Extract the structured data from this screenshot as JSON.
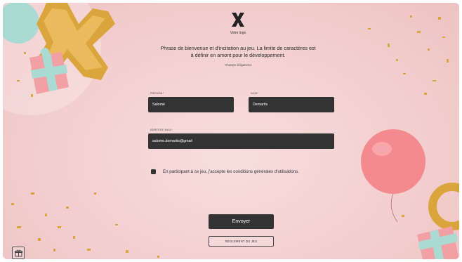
{
  "logo": {
    "caption": "Votre logo",
    "icon": "x-logo-icon"
  },
  "intro": {
    "line1": "Phrase de bienvenue et d'incitation au jeu. La limite de caractères est",
    "line2": "à définir en amont pour le développement.",
    "required_note": "*champs obligatoires"
  },
  "form": {
    "firstname": {
      "label": "PRÉNOM*",
      "value": "Salomé"
    },
    "lastname": {
      "label": "NOM*",
      "value": "Demartis"
    },
    "email": {
      "label": "ADRESSE MAIL*",
      "value": "salome.demartis@gmail"
    },
    "consent": {
      "label": "En participant à ce jeu, j'accepte les conditions générales d'utilisations.",
      "checked": false
    }
  },
  "actions": {
    "submit": "Envoyer",
    "rules": "RÉGLEMENT DU JEU"
  },
  "colors": {
    "background": "#f3cfcf",
    "field": "#333333",
    "gold": "#d9a53c",
    "balloon": "#f28a8f",
    "mint": "#a9dbd3"
  }
}
